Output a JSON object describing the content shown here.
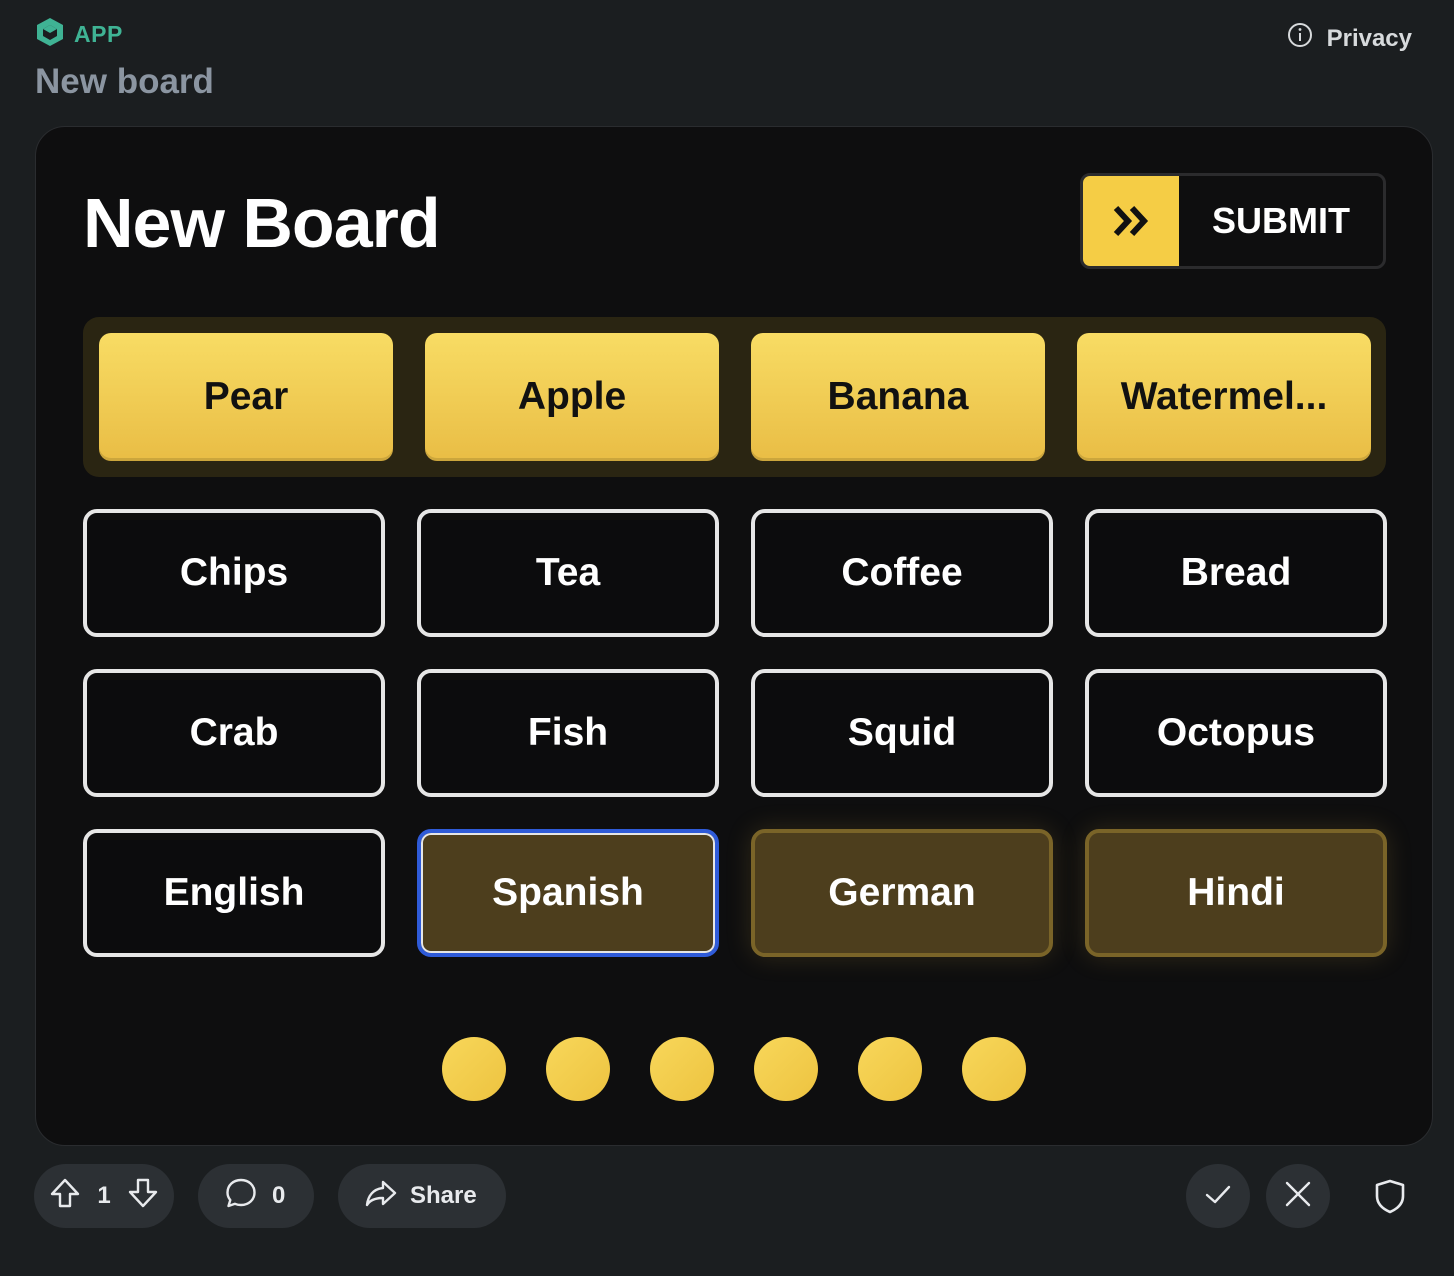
{
  "header": {
    "brand_label": "APP",
    "post_title": "New board",
    "privacy_label": "Privacy"
  },
  "game": {
    "title": "New Board",
    "submit_label": "SUBMIT",
    "solved_group": [
      "Pear",
      "Apple",
      "Banana",
      "Watermel..."
    ],
    "grid": [
      [
        "Chips",
        "Tea",
        "Coffee",
        "Bread"
      ],
      [
        "Crab",
        "Fish",
        "Squid",
        "Octopus"
      ],
      [
        "English",
        "Spanish",
        "German",
        "Hindi"
      ]
    ],
    "selected_tiles": [
      "Spanish",
      "German",
      "Hindi"
    ],
    "focused_tile": "Spanish",
    "lives_remaining": 6,
    "colors": {
      "accent_yellow": "#f5cd45",
      "selected_tile_bg": "#4d3e1d",
      "focus_ring": "#2f5bd8",
      "brand_green": "#3fb394"
    }
  },
  "actions": {
    "upvote_count": "1",
    "comment_count": "0",
    "share_label": "Share",
    "icons": [
      "upvote-icon",
      "downvote-icon",
      "comment-icon",
      "share-icon",
      "checkmark-icon",
      "close-icon",
      "shield-icon"
    ]
  }
}
